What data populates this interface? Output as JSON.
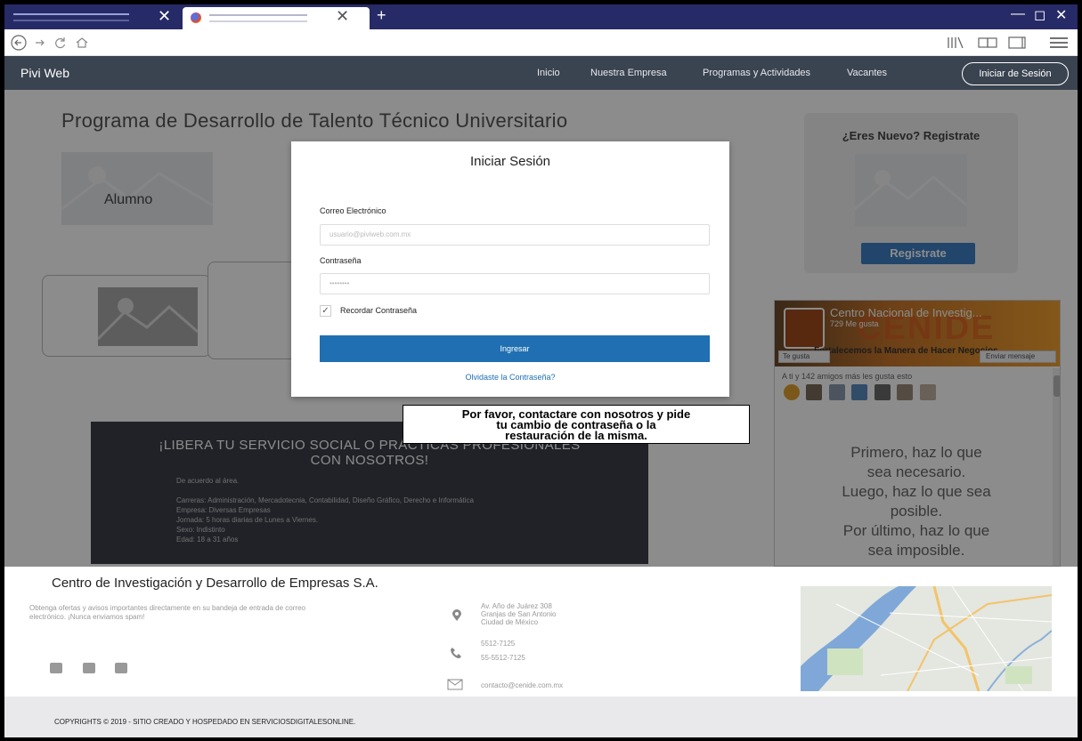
{
  "browser": {
    "new_tab_symbol": "+",
    "tab_close_symbol": "✕",
    "window_minimize": "—",
    "window_restore": "◻",
    "window_close": "✕"
  },
  "site": {
    "brand": "Pivi Web",
    "menu": [
      "Inicio",
      "Nuestra Empresa",
      "Programas y Actividades",
      "Vacantes"
    ],
    "login_button": "Iniciar de Sesión"
  },
  "content": {
    "program_title": "Programa de Desarrollo de Talento Técnico Universitario",
    "alumno_label": "Alumno",
    "register_title": "¿Eres Nuevo? Registrate",
    "register_button": "Registrate",
    "promo": {
      "title_line1": "¡LIBERA TU SERVICIO SOCIAL O PRÁCTICAS PROFESIONALES",
      "title_line2": "CON NOSOTROS!",
      "items": [
        "De acuerdo al área.",
        "",
        "Carreras: Administración, Mercadotecnia, Contabilidad, Diseño Gráfico, Derecho e Informática",
        "Empresa: Diversas Empresas",
        "Jornada: 5 horas diarias de Lunes a Viernes.",
        "Sexo: Indistinto",
        "Edad: 18 a 31 años"
      ]
    },
    "facebook": {
      "page_name": "Centro Nacional de Investig...",
      "likes": "729 Me gusta",
      "cover_text": "CENIDE",
      "slogan": "Fortalecemos la Manera de Hacer Negocios",
      "like_button": "Te gusta",
      "message_button": "Enviar mensaje",
      "friends_text": "A ti y 142 amigos más les gusta esto",
      "post_quote": [
        "Primero, haz lo que",
        "sea necesario.",
        "Luego, haz lo que sea",
        "posible.",
        "Por último, haz lo que",
        "sea imposible."
      ]
    }
  },
  "modal": {
    "title": "Iniciar Sesión",
    "email_label": "Correo Electrónico",
    "email_placeholder": "usuario@piviweb.com.mx",
    "password_label": "Contraseña",
    "password_placeholder": "••••••••",
    "remember_label": "Recordar Contraseña",
    "remember_checked": true,
    "submit": "Ingresar",
    "forgot": "Olvidaste la Contraseña?"
  },
  "tooltip": {
    "lines": [
      "Por favor, contactare con nosotros y pide",
      "tu cambio de contraseña o la",
      "restauración de la misma."
    ]
  },
  "footer": {
    "company": "Centro de Investigación y Desarrollo de Empresas S.A.",
    "newsletter": "Obtenga ofertas y avisos importantes directamente en su bandeja de entrada de correo electrónico. ¡Nunca enviamos spam!",
    "address": [
      "Av. Año de Juárez 308",
      "Granjas de San Antonio",
      "Ciudad de México"
    ],
    "phones": [
      "5512-7125",
      "55-5512-7125"
    ],
    "email": "contacto@cenide.com.mx",
    "copyright": "COPYRIGHTS © 2019 - SITIO CREADO Y HOSPEDADO EN SERVICIOSDIGITALESONLINE."
  },
  "colors": {
    "header_bg": "#3a4350",
    "primary": "#1f6fb2",
    "register_button": "#3d7fc4",
    "tabbar": "#262a66"
  },
  "icons": {
    "back": "back-icon",
    "forward": "forward-icon",
    "reload": "reload-icon",
    "home": "home-icon",
    "library": "library-icon",
    "reader": "reader-icon",
    "sidebar": "sidebar-icon",
    "menu": "hamburger-menu-icon"
  }
}
